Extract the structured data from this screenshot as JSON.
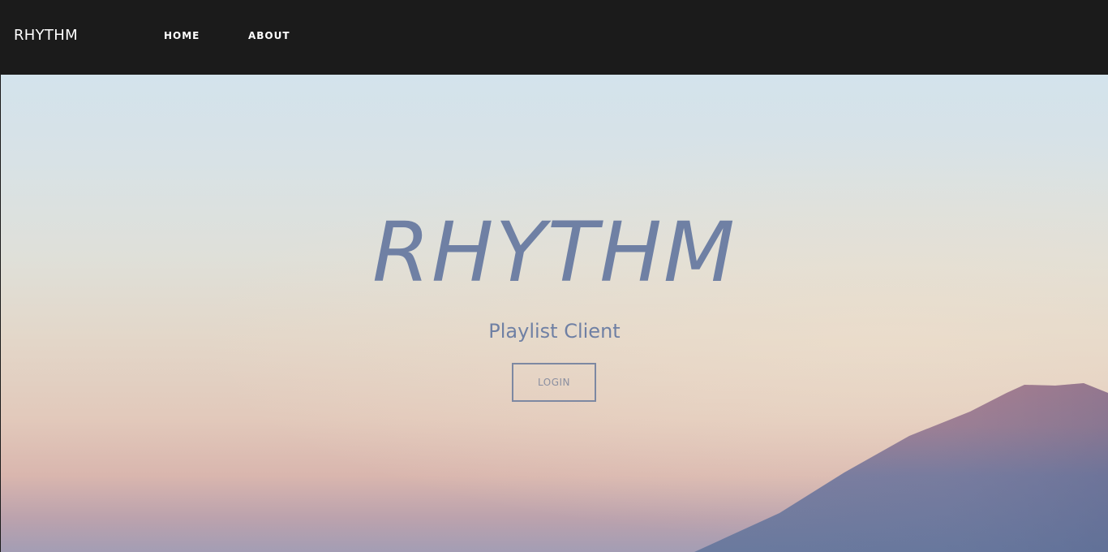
{
  "navbar": {
    "brand": "RHYTHM",
    "links": [
      {
        "label": "HOME"
      },
      {
        "label": "ABOUT"
      }
    ]
  },
  "hero": {
    "title": "RHYTHM",
    "subtitle": "Playlist Client",
    "login_label": "LOGIN"
  },
  "colors": {
    "navbar_bg": "#1b1b1b",
    "hero_text": "#6f80a4",
    "button_border": "#7d88a2",
    "mountain": "#6c7b9f",
    "mountain_peak": "#b8838f"
  }
}
